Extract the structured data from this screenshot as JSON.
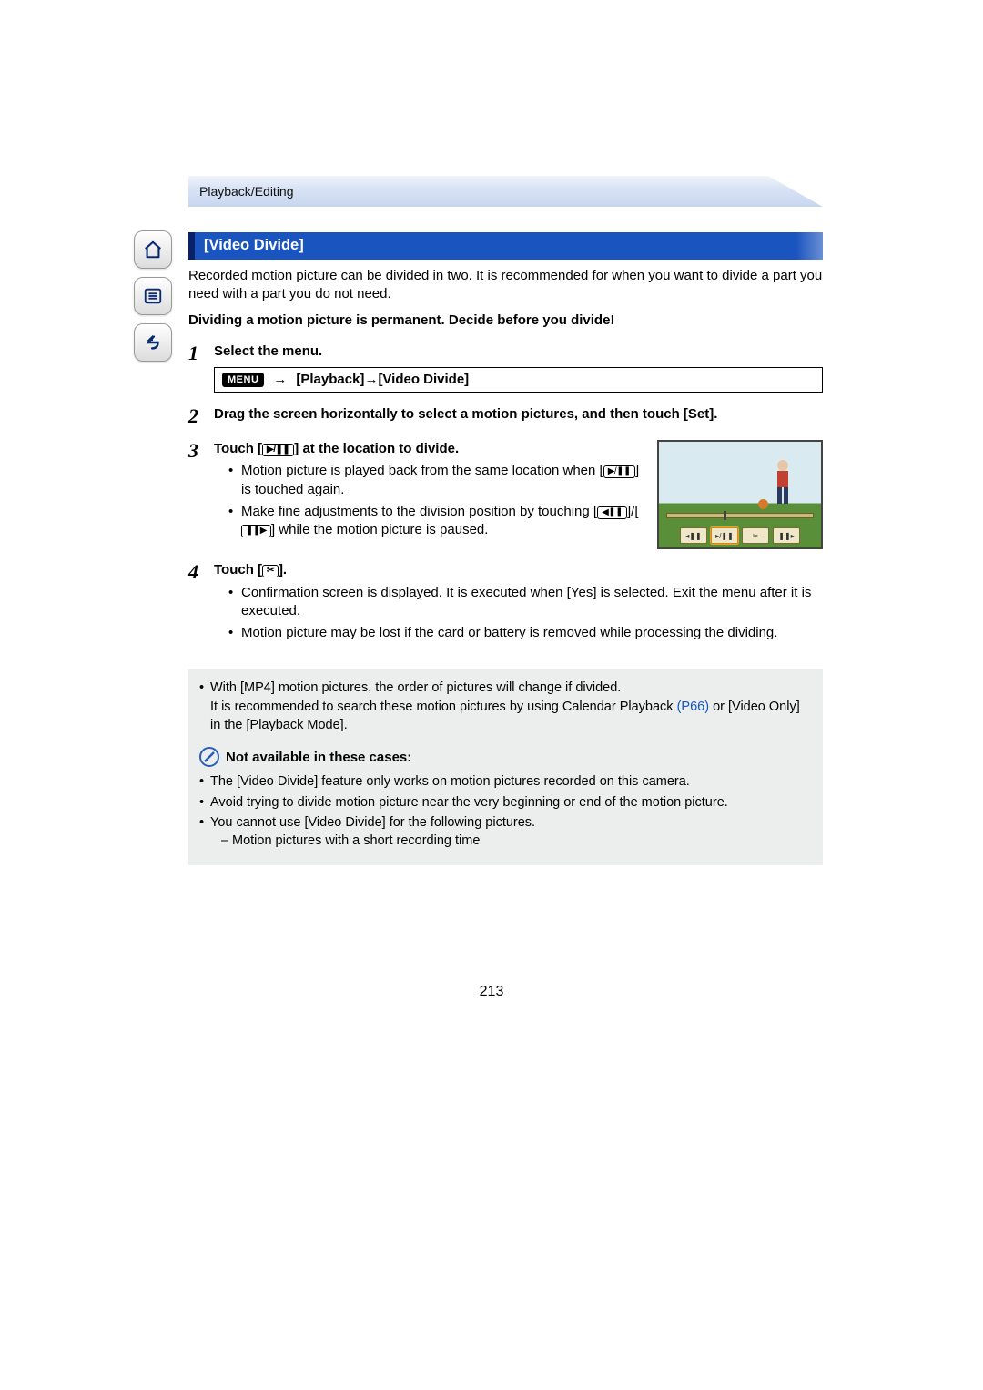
{
  "chapter": "Playback/Editing",
  "section_title": "[Video Divide]",
  "intro": "Recorded motion picture can be divided in two. It is recommended for when you want to divide a part you need with a part you do not need.",
  "warning": "Dividing a motion picture is permanent. Decide before you divide!",
  "menu_badge": "MENU",
  "arrow": "→",
  "menu_path_1": "[Playback]",
  "menu_path_2": "[Video Divide]",
  "step1_title": "Select the menu.",
  "step2_title": "Drag the screen horizontally to select a motion pictures, and then touch [Set].",
  "step3_title_pre": "Touch [",
  "step3_title_post": "] at the location to divide.",
  "step3_b1_pre": "Motion picture is played back from the same location when [",
  "step3_b1_post": "] is touched again.",
  "step3_b2_pre": "Make fine adjustments to the division position by touching [",
  "step3_b2_mid": "]/[",
  "step3_b2_post": "] while the motion picture is paused.",
  "step4_title_pre": "Touch [",
  "step4_title_post": "].",
  "step4_b1": "Confirmation screen is displayed. It is executed when [Yes] is selected. Exit the menu after it is executed.",
  "step4_b2": "Motion picture may be lost if the card or battery is removed while processing the dividing.",
  "note_mp4_a": "With [MP4] motion pictures, the order of pictures will change if divided.",
  "note_mp4_b_pre": "It is recommended to search these motion pictures by using Calendar Playback ",
  "note_mp4_link": "(P66)",
  "note_mp4_b_post": " or [Video Only] in the [Playback Mode].",
  "na_title": "Not available in these cases:",
  "na_b1": "The [Video Divide] feature only works on motion pictures recorded on this camera.",
  "na_b2": "Avoid trying to divide motion picture near the very beginning or end of the motion picture.",
  "na_b3": "You cannot use [Video Divide] for the following pictures.",
  "na_b3_sub1": "Motion pictures with a short recording time",
  "page_number": "213",
  "icons": {
    "play_pause": "▶/❚❚",
    "frame_back": "◀❚❚",
    "frame_fwd": "❚❚▶",
    "divide": "✂"
  }
}
